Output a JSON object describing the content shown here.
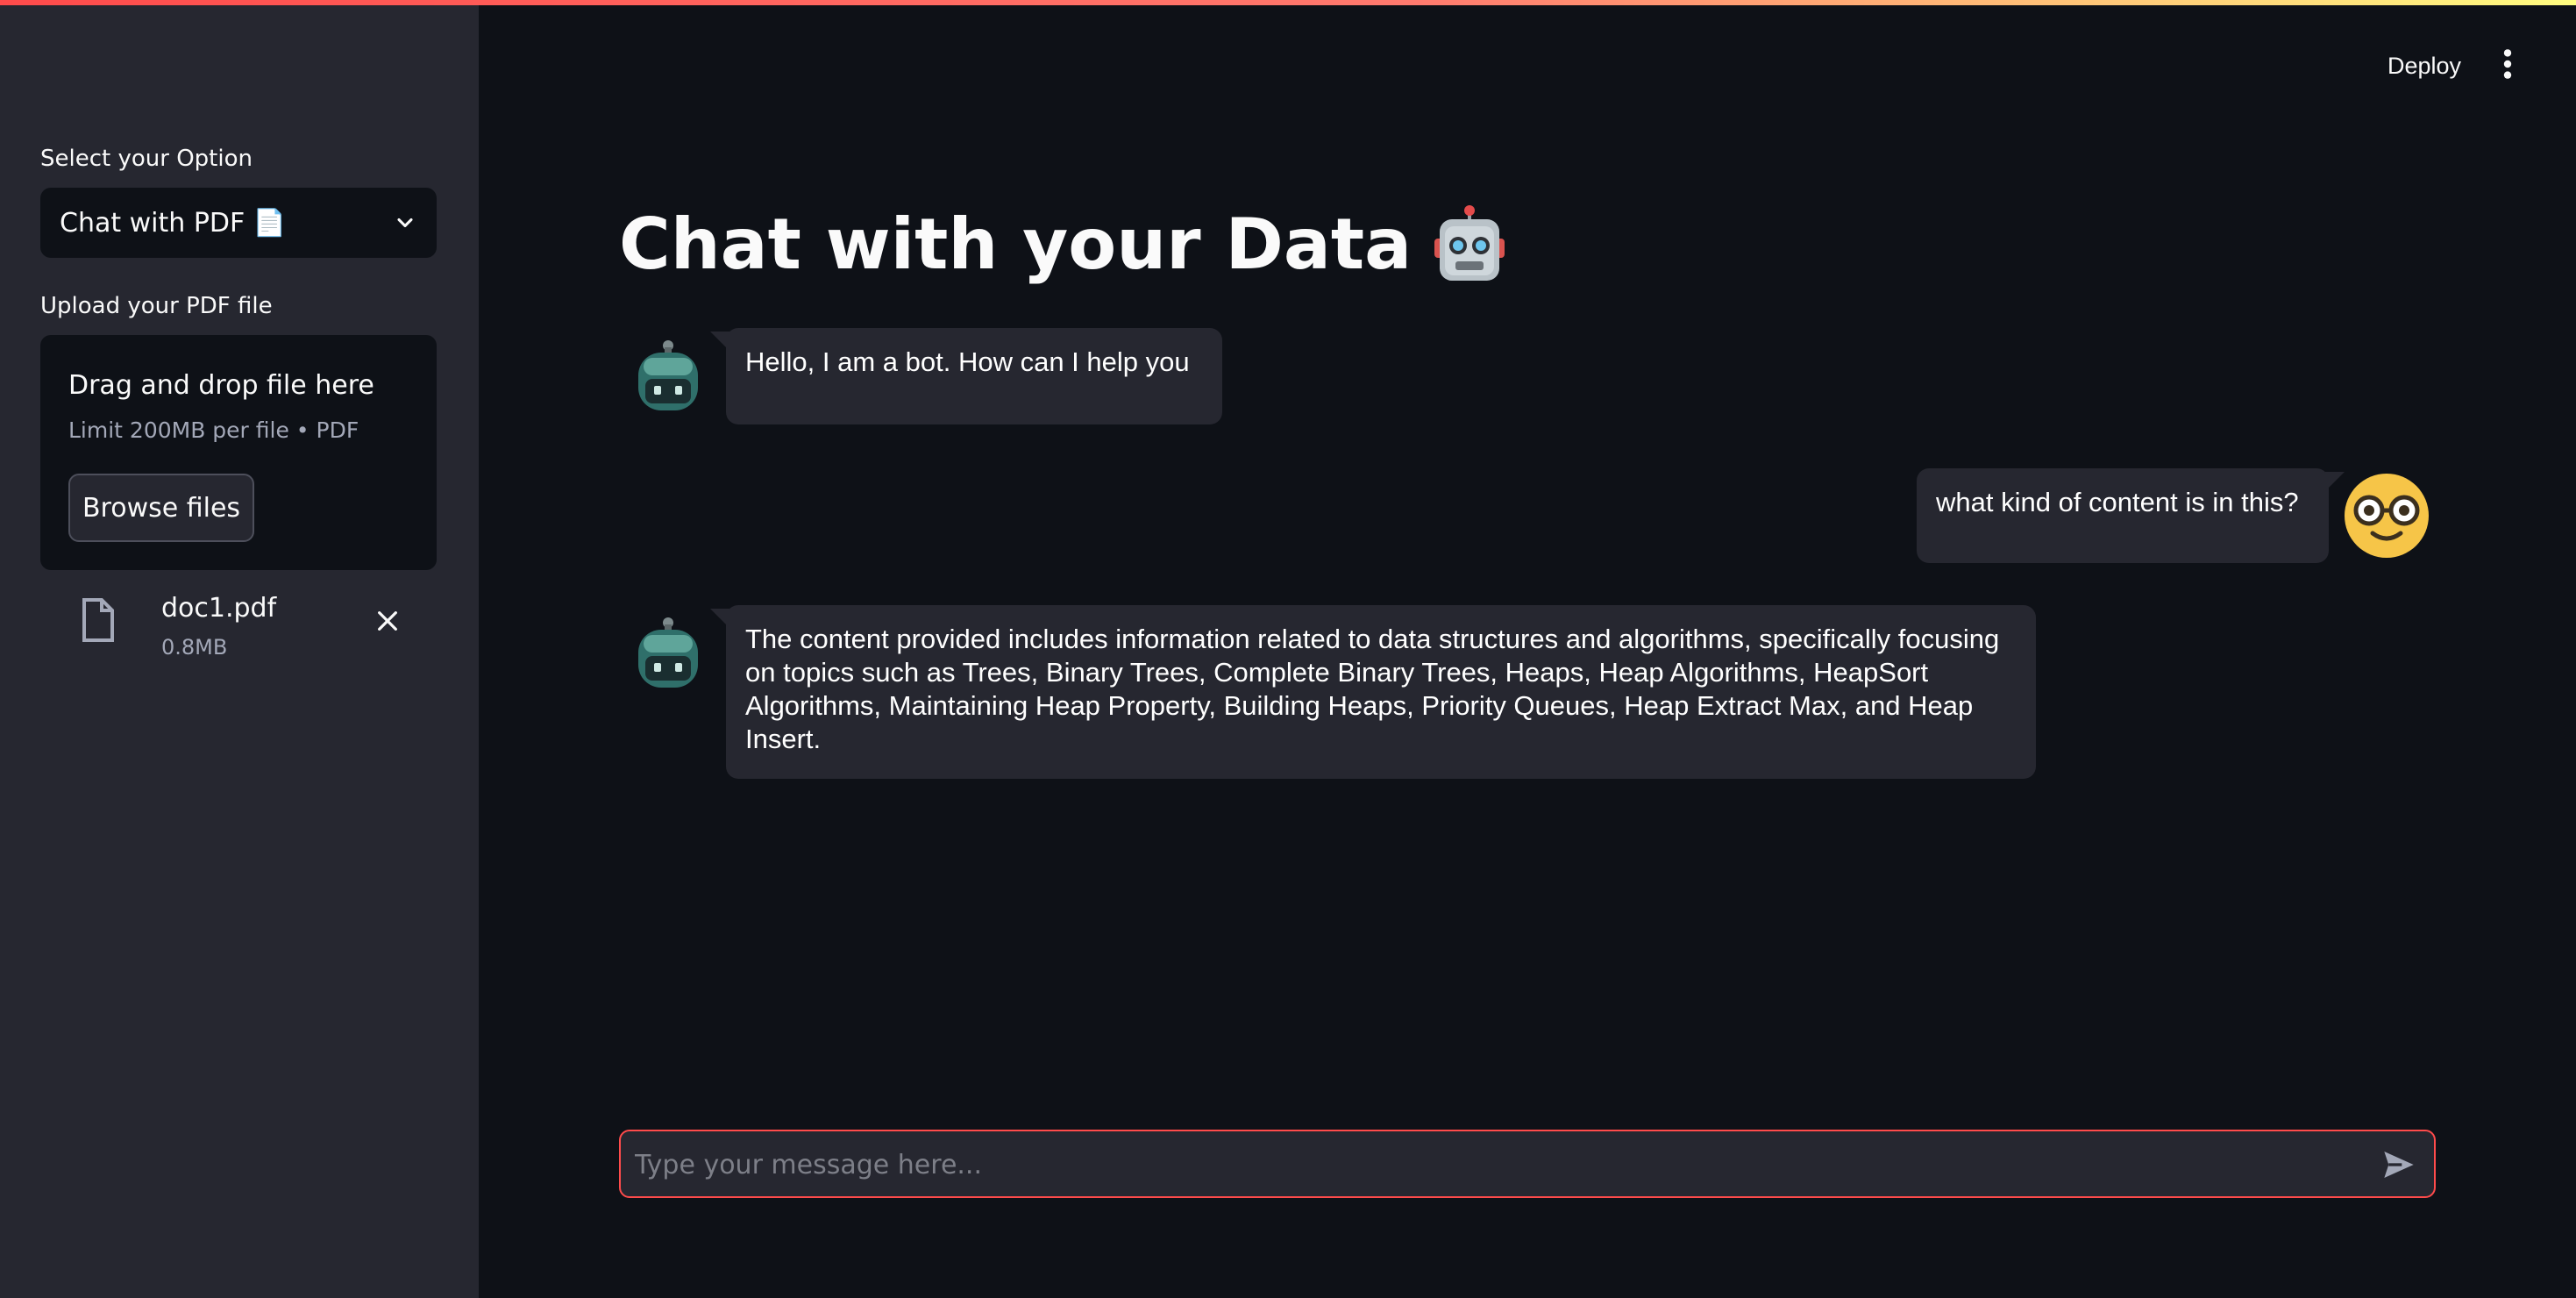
{
  "sidebar": {
    "select_label": "Select your Option",
    "select_value": "Chat with PDF 📄",
    "upload_label": "Upload your PDF file",
    "uploader": {
      "title": "Drag and drop file here",
      "limit": "Limit 200MB per file • PDF",
      "browse_label": "Browse files"
    },
    "file": {
      "name": "doc1.pdf",
      "size": "0.8MB"
    }
  },
  "header": {
    "deploy_label": "Deploy"
  },
  "main": {
    "title": "Chat with your Data",
    "title_icon": "robot-face-icon",
    "messages": [
      {
        "role": "assistant",
        "text": "Hello, I am a bot. How can I help you"
      },
      {
        "role": "user",
        "text": "what kind of content is in this?"
      },
      {
        "role": "assistant",
        "text": "The content provided includes information related to data structures and algorithms, specifically focusing on topics such as Trees, Binary Trees, Complete Binary Trees, Heaps, Heap Algorithms, HeapSort Algorithms, Maintaining Heap Property, Building Heaps, Priority Queues, Heap Extract Max, and Heap Insert."
      }
    ]
  },
  "chat_input": {
    "placeholder": "Type your message here..."
  },
  "colors": {
    "background": "#0e1117",
    "sidebar": "#262730",
    "accent": "#ff4b4b"
  }
}
